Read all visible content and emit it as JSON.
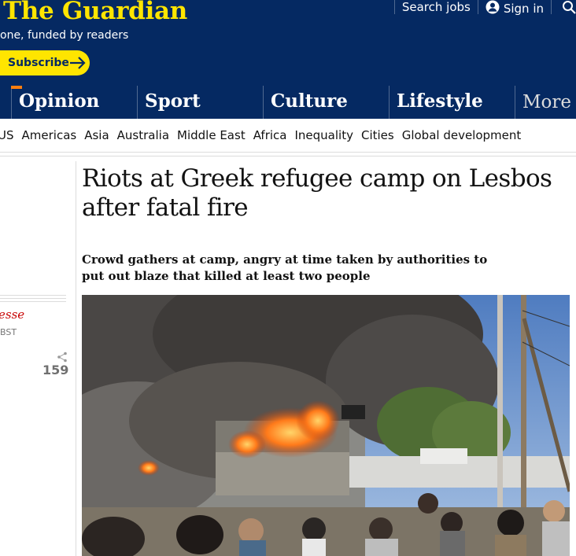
{
  "header": {
    "logo": "The Guardian",
    "tagline": "one, funded by readers",
    "subscribe_label": "Subscribe",
    "search_jobs_label": "Search jobs",
    "sign_in_label": "Sign in",
    "icons": {
      "subscribe_arrow": "arrow-right-icon",
      "account": "account-icon",
      "search": "search-icon"
    }
  },
  "pillars": [
    {
      "label": "Opinion"
    },
    {
      "label": "Sport"
    },
    {
      "label": "Culture"
    },
    {
      "label": "Lifestyle"
    },
    {
      "label": "More"
    }
  ],
  "subnav": [
    "US",
    "Americas",
    "Asia",
    "Australia",
    "Middle East",
    "Africa",
    "Inequality",
    "Cities",
    "Global development"
  ],
  "sidebar": {
    "byline": "esse",
    "timestamp_fragment": "BST",
    "share_count": "159",
    "share_icon": "share-icon"
  },
  "article": {
    "headline": "Riots at Greek refugee camp on Lesbos after fatal fire",
    "standfirst": "Crowd gathers at camp, angry at time taken by authorities to put out blaze that killed at least two people"
  },
  "colors": {
    "brand_blue": "#052962",
    "brand_yellow": "#ffe500",
    "opinion_orange": "#ff7f0f",
    "news_red": "#c70000"
  }
}
